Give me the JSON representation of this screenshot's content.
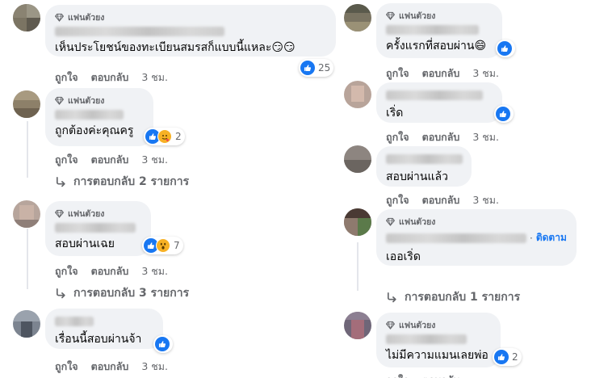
{
  "badge_label": "แฟนตัวยง",
  "actions": {
    "like": "ถูกใจ",
    "reply": "ตอบกลับ"
  },
  "colors": {
    "bubble": "#f0f2f5",
    "like_blue": "#1877f2",
    "meta_gray": "#65676b",
    "follow_blue": "#1877f2"
  },
  "left_comments": [
    {
      "text": "เห็นประโยชน์ของทะเบียนสมรสก็แบบนี้แหละ😏😏",
      "reactions": {
        "icons": [
          "like-icon"
        ],
        "count": "25"
      },
      "time": "3 ชม."
    },
    {
      "text": "ถูกต้องค่ะคุณครู",
      "reactions": {
        "icons": [
          "like-icon",
          "care-icon"
        ],
        "count": "2"
      },
      "time": "3 ชม.",
      "replies": "การตอบกลับ 2 รายการ"
    },
    {
      "text": "สอบผ่านเฉย",
      "reactions": {
        "icons": [
          "like-icon",
          "wow-icon"
        ],
        "count": "7"
      },
      "time": "3 ชม.",
      "replies": "การตอบกลับ 3 รายการ"
    },
    {
      "text": "เรื่อนนี้สอบผ่านจ้า",
      "reactions": {
        "icons": [
          "like-icon"
        ],
        "count": ""
      },
      "time": "3 ชม."
    }
  ],
  "right_comments": [
    {
      "text": "ครั้งแรกที่สอบผ่าน😄",
      "reactions": {
        "icons": [
          "like-icon"
        ],
        "count": ""
      },
      "time": "3 ชม."
    },
    {
      "text": "เริ่ด",
      "reactions": {
        "icons": [
          "like-icon"
        ],
        "count": ""
      },
      "time": "3 ชม."
    },
    {
      "text": "สอบผ่านแล้ว",
      "time": "3 ชม."
    },
    {
      "text": "เออเริ่ด",
      "follow": "ติดตาม",
      "dot": "·",
      "replies": "การตอบกลับ 1 รายการ"
    },
    {
      "text": "ไม่มีความแมนเลยพ่อ",
      "reactions": {
        "icons": [
          "like-icon"
        ],
        "count": "2"
      }
    }
  ]
}
